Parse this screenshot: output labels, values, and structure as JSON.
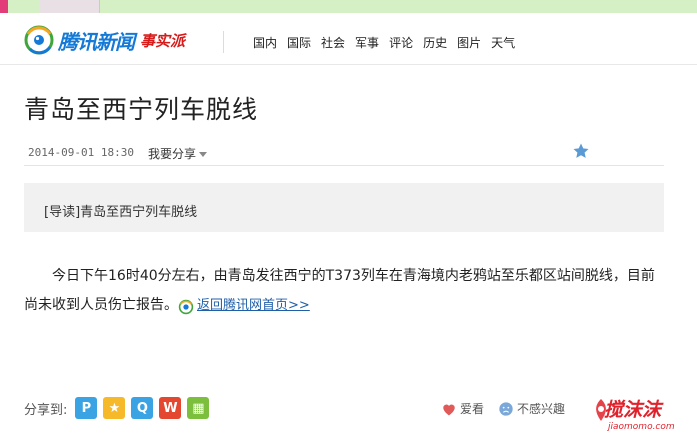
{
  "header": {
    "logo_text": "腾讯新闻",
    "logo_sub": "事实派",
    "nav": [
      "国内",
      "国际",
      "社会",
      "军事",
      "评论",
      "历史",
      "图片",
      "天气"
    ]
  },
  "article": {
    "title": "青岛至西宁列车脱线",
    "timestamp": "2014-09-01  18:30",
    "share_menu_label": "我要分享",
    "lead_prefix": "[导读]",
    "lead_text": "青岛至西宁列车脱线",
    "body": "今日下午16时40分左右，由青岛发往西宁的T373列车在青海境内老鸦站至乐都区站间脱线，目前尚未收到人员伤亡报告。",
    "back_link": "返回腾讯网首页>>"
  },
  "share_bar": {
    "label": "分享到:",
    "buttons": [
      {
        "icon": "pengyou-icon",
        "glyph": "P",
        "color": "#3aa3e3"
      },
      {
        "icon": "qzone-star-icon",
        "glyph": "★",
        "color": "#f6b92a"
      },
      {
        "icon": "qq-icon",
        "glyph": "Q",
        "color": "#3aa3e3"
      },
      {
        "icon": "weibo-icon",
        "glyph": "W",
        "color": "#e3472f"
      },
      {
        "icon": "qrcode-icon",
        "glyph": "▦",
        "color": "#7cbf3c"
      }
    ]
  },
  "reactions": {
    "like_label": "爱看",
    "dislike_label": "不感兴趣"
  },
  "watermark": {
    "main": "搅沫沫",
    "sub": "jiaomomo.com"
  },
  "colors": {
    "brand_blue": "#1479d7",
    "accent_red": "#d71a1a",
    "link_blue": "#1f5fa8",
    "lead_bg": "#f1f1f1"
  }
}
